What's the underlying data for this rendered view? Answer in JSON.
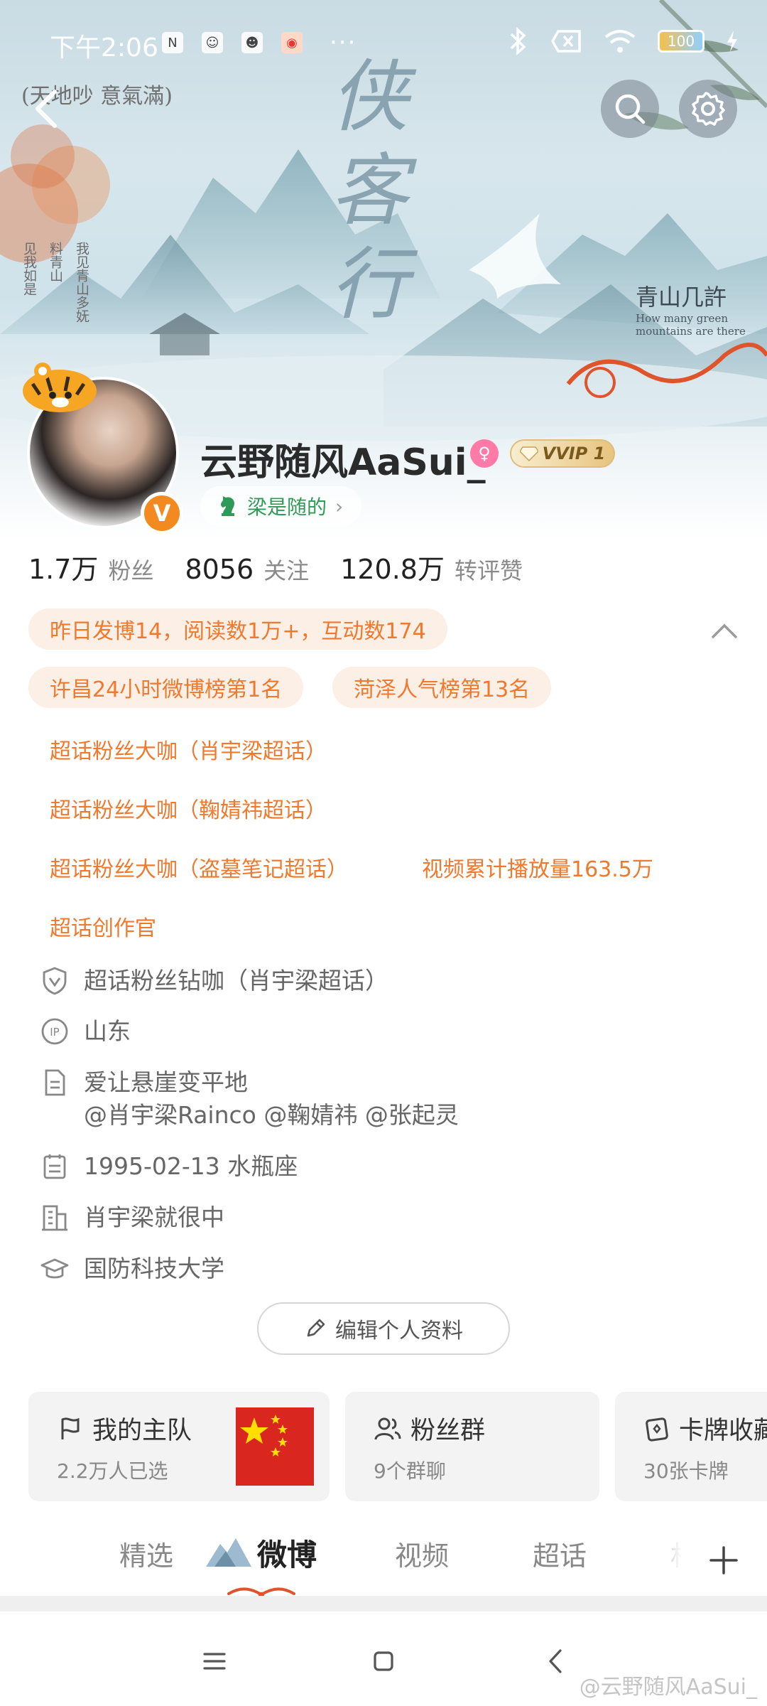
{
  "status_bar": {
    "time": "下午2:06",
    "dots": "···",
    "battery": "100"
  },
  "banner": {
    "calligraphy": "侠客行",
    "seal_text": "(天地吵 意氣滿)",
    "poem_cols": [
      "见我如是",
      "料青山",
      "我见青山多妩"
    ],
    "qingshan_title": "青山几許",
    "qingshan_en_1": "How many green",
    "qingshan_en_2": "mountains are there"
  },
  "profile": {
    "username": "云野随风AaSui_",
    "female_symbol": "♀",
    "vvip_label": "VVIP 1",
    "verified_badge": "V",
    "tag_label": "梁是随的",
    "tag_chevron": "›"
  },
  "stats": [
    {
      "value": "1.7万",
      "label": "粉丝"
    },
    {
      "value": "8056",
      "label": "关注"
    },
    {
      "value": "120.8万",
      "label": "转评赞"
    }
  ],
  "summary_tag": "昨日发博14，阅读数1万+，互动数174",
  "honor_tags": {
    "xuchang": "许昌24小时微博榜第1名",
    "heze": "菏泽人气榜第13名",
    "fan1": "超话粉丝大咖（肖宇梁超话）",
    "fan2": "超话粉丝大咖（鞠婧祎超话）",
    "fan3": "超话粉丝大咖（盗墓笔记超话）",
    "views": "视频累计播放量163.5万",
    "creator": "超话创作官"
  },
  "info": {
    "diamond": "超话粉丝钻咖（肖宇梁超话）",
    "ip": "山东",
    "bio_line1": "爱让悬崖变平地",
    "bio_line2": "@肖宇梁Rainco @鞠婧祎 @张起灵",
    "birthday": "1995-02-13 水瓶座",
    "work": "肖宇梁就很中",
    "school": "国防科技大学"
  },
  "edit_button": "编辑个人资料",
  "cards": [
    {
      "title": "我的主队",
      "sub": "2.2万人已选"
    },
    {
      "title": "粉丝群",
      "sub": "9个群聊"
    },
    {
      "title": "卡牌收藏",
      "sub": "30张卡牌"
    }
  ],
  "tabs": [
    "精选",
    "微博",
    "视频",
    "超话",
    "相册"
  ],
  "watermark": "@云野随风AaSui_",
  "icons": {
    "back": "back-arrow-icon",
    "search": "search-icon",
    "settings": "gear-icon",
    "add": "plus-icon"
  },
  "colors": {
    "accent_orange": "#f0792d",
    "tag_green": "#2f9a57",
    "verified_orange": "#f28a1f"
  }
}
